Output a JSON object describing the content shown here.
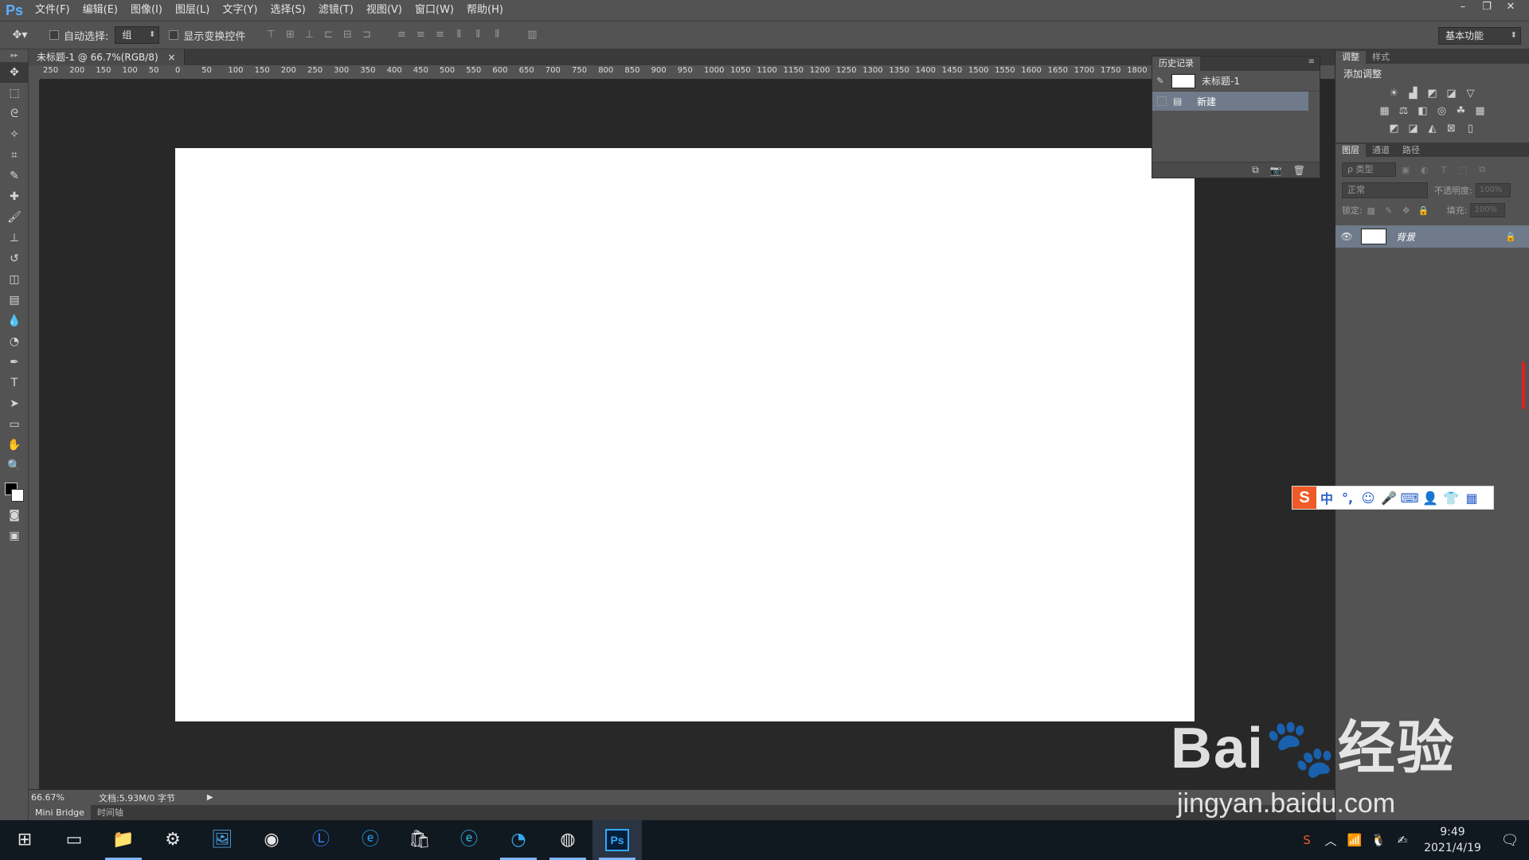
{
  "app": {
    "logo": "Ps"
  },
  "menu": [
    "文件(F)",
    "编辑(E)",
    "图像(I)",
    "图层(L)",
    "文字(Y)",
    "选择(S)",
    "滤镜(T)",
    "视图(V)",
    "窗口(W)",
    "帮助(H)"
  ],
  "window_controls": [
    "–",
    "❐",
    "✕"
  ],
  "options": {
    "auto_select_label": "自动选择:",
    "auto_select_value": "组",
    "show_transform_label": "显示变换控件",
    "workspace": "基本功能"
  },
  "document": {
    "tab_title": "未标题-1 @ 66.7%(RGB/8)",
    "tab_close": "×",
    "zoom": "66.67%",
    "doc_info": "文档:5.93M/0 字节"
  },
  "ruler_ticks": [
    "250",
    "200",
    "150",
    "100",
    "50",
    "0",
    "50",
    "100",
    "150",
    "200",
    "250",
    "300",
    "350",
    "400",
    "450",
    "500",
    "550",
    "600",
    "650",
    "700",
    "750",
    "800",
    "850",
    "900",
    "950",
    "1000",
    "1050",
    "1100",
    "1150",
    "1200",
    "1250",
    "1300",
    "1350",
    "1400",
    "1450",
    "1500",
    "1550",
    "1600",
    "1650",
    "1700",
    "1750",
    "1800"
  ],
  "bottom_tabs": [
    "Mini Bridge",
    "时间轴"
  ],
  "history": {
    "tab": "历史记录",
    "snapshot": "未标题-1",
    "step": "新建"
  },
  "adjustments": {
    "tabs": [
      "调整",
      "样式"
    ],
    "title": "添加调整"
  },
  "layers": {
    "tabs": [
      "图层",
      "通道",
      "路径"
    ],
    "filter": "ρ 类型",
    "blend_mode": "正常",
    "opacity_label": "不透明度:",
    "opacity_value": "100%",
    "lock_label": "锁定:",
    "fill_label": "填充:",
    "fill_value": "100%",
    "items": [
      {
        "name": "背景"
      }
    ]
  },
  "ime": {
    "logo": "S",
    "items": [
      "中",
      "°,",
      "☺",
      "🎤",
      "⌨",
      "👤",
      "👕",
      "▦"
    ]
  },
  "watermark": {
    "main": "Bai🐾经验",
    "sub": "jingyan.baidu.com"
  },
  "taskbar": {
    "clock_time": "9:49",
    "clock_date": "2021/4/19",
    "ps_label": "Ps"
  }
}
